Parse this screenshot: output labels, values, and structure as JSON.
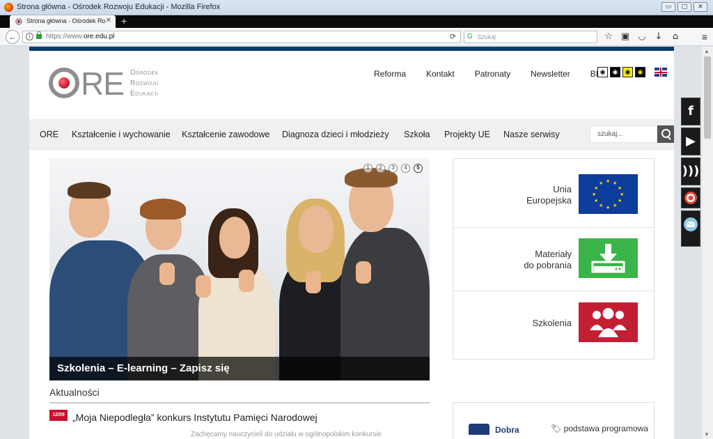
{
  "window": {
    "title": "Strona główna - Ośrodek Rozwoju Edukacji - Mozilla Firefox",
    "tab_title": "Strona główna - Ośrodek Ro",
    "url_prefix": "https://www.",
    "url_domain": "ore.edu.pl",
    "search_placeholder": "Szukaj"
  },
  "logo": {
    "mark": "RE",
    "line1": "Ośrodek",
    "line2": "Rozwoju",
    "line3": "Edukacji"
  },
  "top_links": [
    "Reforma",
    "Kontakt",
    "Patronaty",
    "Newsletter",
    "BIP"
  ],
  "main_nav": [
    "ORE",
    "Kształcenie i wychowanie",
    "Kształcenie zawodowe",
    "Diagnoza dzieci i młodzieży",
    "Szkoła",
    "Projekty UE",
    "Nasze serwisy"
  ],
  "site_search_placeholder": "szukaj...",
  "slider": {
    "dots": [
      "1",
      "2",
      "3",
      "4",
      "5"
    ],
    "active_dot": "5",
    "caption": "Szkolenia – E-learning – Zapisz się"
  },
  "news": {
    "heading": "Aktualności",
    "date": "12/09",
    "headline": "„Moja Niepodległa” konkurs Instytutu Pamięci Narodowej",
    "teaser": "Zachęcamy nauczycieli do udziału w ogólnopolskim konkursie"
  },
  "right_panel": {
    "eu_label_1": "Unia",
    "eu_label_2": "Europejska",
    "dl_label_1": "Materiały",
    "dl_label_2": "do pobrania",
    "training_label": "Szkolenia"
  },
  "bottom_box": {
    "brand": "Dobra",
    "tag": "podstawa programowa"
  },
  "colors": {
    "brand_red": "#c8102e",
    "navy": "#0b3a6e",
    "eu_blue": "#0d3d9a",
    "green": "#3bb44a",
    "red_tile": "#c41e33"
  }
}
